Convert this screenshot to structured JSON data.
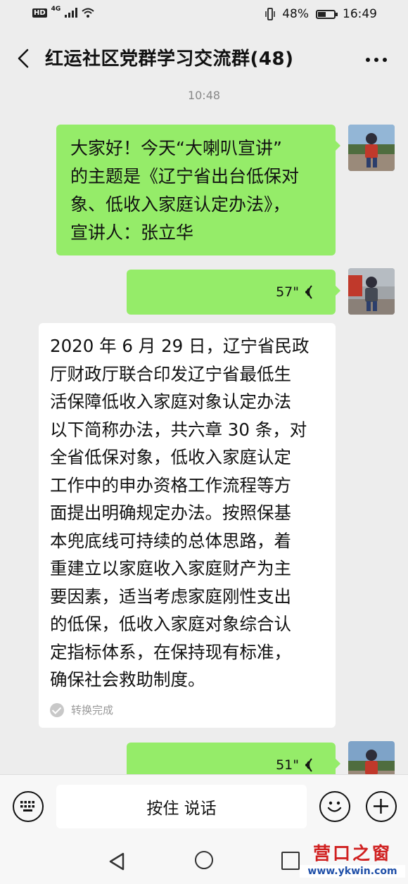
{
  "status_bar": {
    "hd": "HD",
    "network": "4G",
    "battery_text": "48%",
    "battery_level": 0.48,
    "clock": "16:49"
  },
  "header": {
    "title": "红运社区党群学习交流群(48)",
    "back_icon": "chevron-left-icon",
    "more_icon": "ellipsis-icon"
  },
  "chat": {
    "timestamp": "10:48",
    "messages": [
      {
        "side": "right",
        "type": "text",
        "lines": [
          "大家好！今天“大喇叭宣讲”",
          "的主题是《辽宁省出台低保对",
          "象、低收入家庭认定办法》，",
          "宣讲人：张立华"
        ]
      },
      {
        "side": "right",
        "type": "voice",
        "duration": "57\""
      },
      {
        "side": "left",
        "type": "transcript",
        "lines": [
          "2020 年 6 月 29 日，辽宁省民政",
          "厅财政厅联合印发辽宁省最低生",
          "活保障低收入家庭对象认定办法",
          "以下简称办法，共六章 30 条，对",
          "全省低保对象，低收入家庭认定",
          "工作中的申办资格工作流程等方",
          "面提出明确规定办法。按照保基",
          "本兜底线可持续的总体思路，着",
          "重建立以家庭收入家庭财产为主",
          "要因素，适当考虑家庭刚性支出",
          "的低保，低收入家庭对象综合认",
          "定指标体系，在保持现有标准，",
          "确保社会救助制度。"
        ],
        "status": "转换完成"
      },
      {
        "side": "right",
        "type": "voice",
        "duration": "51\""
      }
    ]
  },
  "input_bar": {
    "hold_to_talk": "按住 说话",
    "keyboard_icon": "keyboard-icon",
    "emoji_icon": "emoji-icon",
    "plus_icon": "plus-icon"
  },
  "watermark": {
    "name": "营口之窗",
    "url": "www.ykwin.com"
  }
}
